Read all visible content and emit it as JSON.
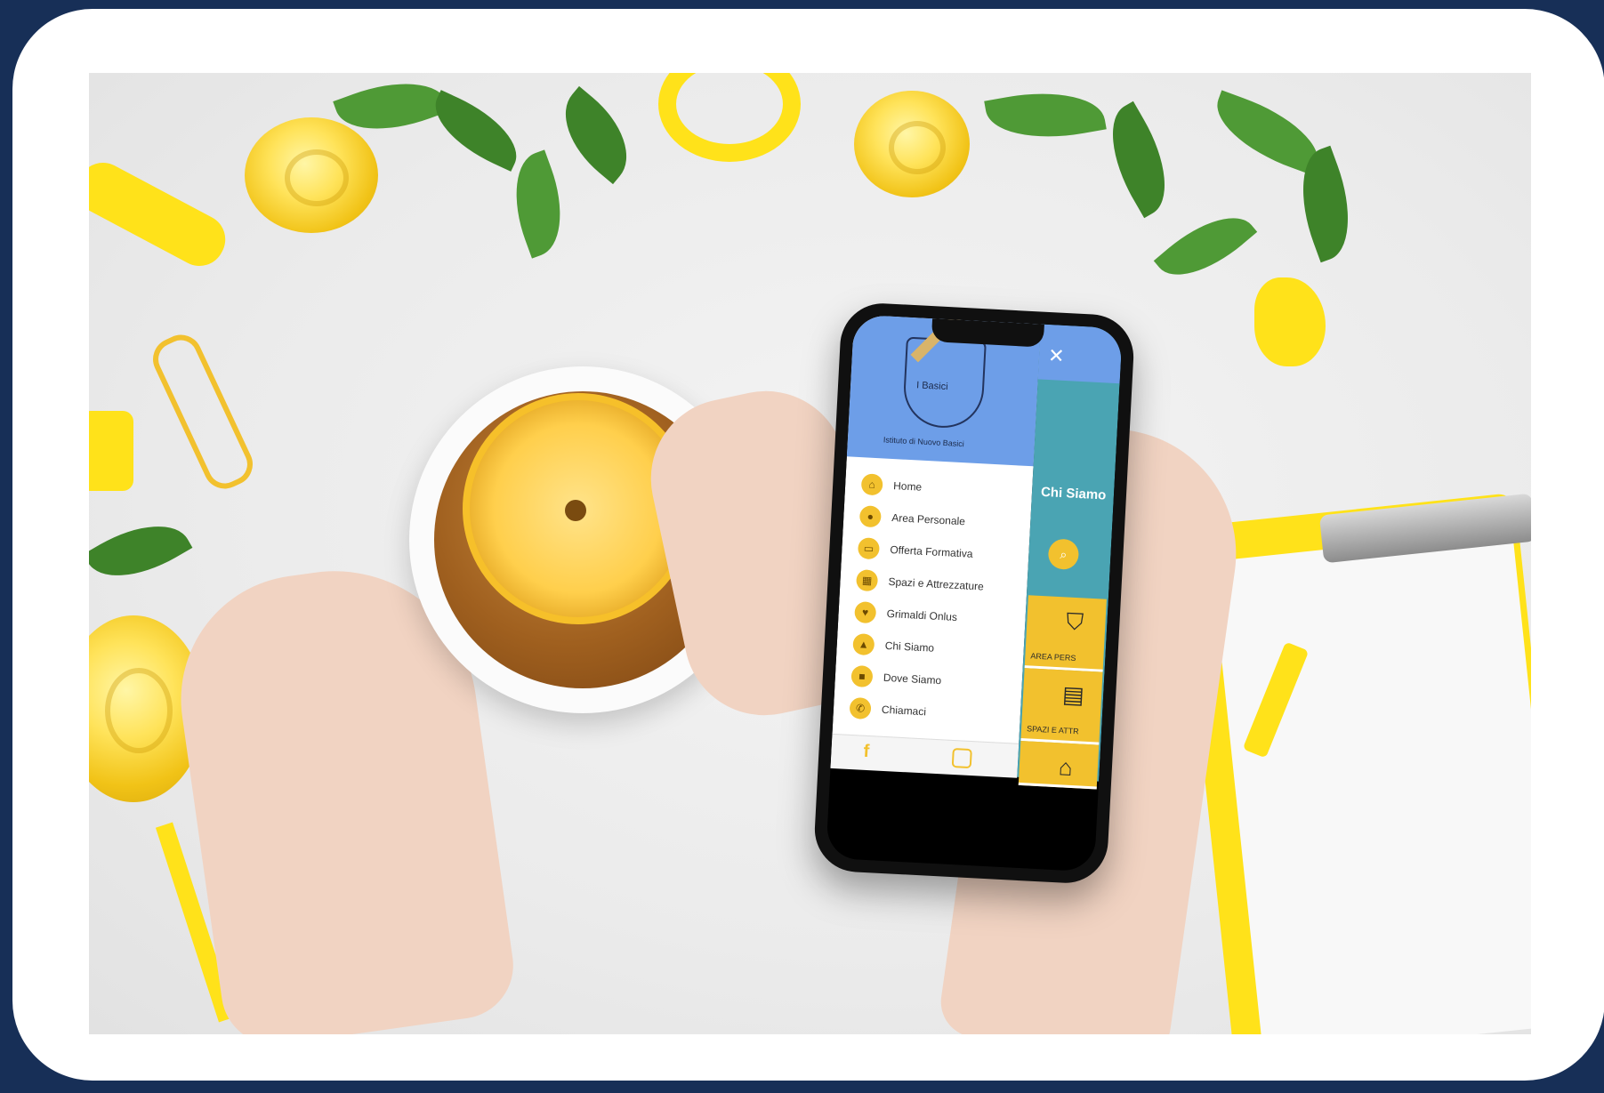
{
  "photo": {
    "subject": "hands holding smartphone and cup of lemon tea"
  },
  "phone_app": {
    "logo_text": "I Basici",
    "logo_subtitle": "Istituto di Nuovo Basici",
    "menu_items": [
      {
        "icon": "home-icon",
        "label": "Home"
      },
      {
        "icon": "user-icon",
        "label": "Area Personale"
      },
      {
        "icon": "book-icon",
        "label": "Offerta Formativa"
      },
      {
        "icon": "building-icon",
        "label": "Spazi e Attrezzature"
      },
      {
        "icon": "heart-icon",
        "label": "Grimaldi Onlus"
      },
      {
        "icon": "people-icon",
        "label": "Chi Siamo"
      },
      {
        "icon": "camera-icon",
        "label": "Dove Siamo"
      },
      {
        "icon": "phone-icon",
        "label": "Chiamaci"
      }
    ],
    "footer": {
      "facebook_glyph": "f",
      "instagram_icon": "instagram-icon"
    },
    "right_pane": {
      "close_glyph": "✕",
      "title": "Chi Siamo",
      "tiles": [
        "AREA PERS",
        "SPAZI E ATTR",
        ""
      ]
    }
  },
  "colors": {
    "frame": "#172f57",
    "accent_yellow": "#f2c12e",
    "menu_header": "#6d9ee8",
    "teal": "#4aa4b3"
  }
}
